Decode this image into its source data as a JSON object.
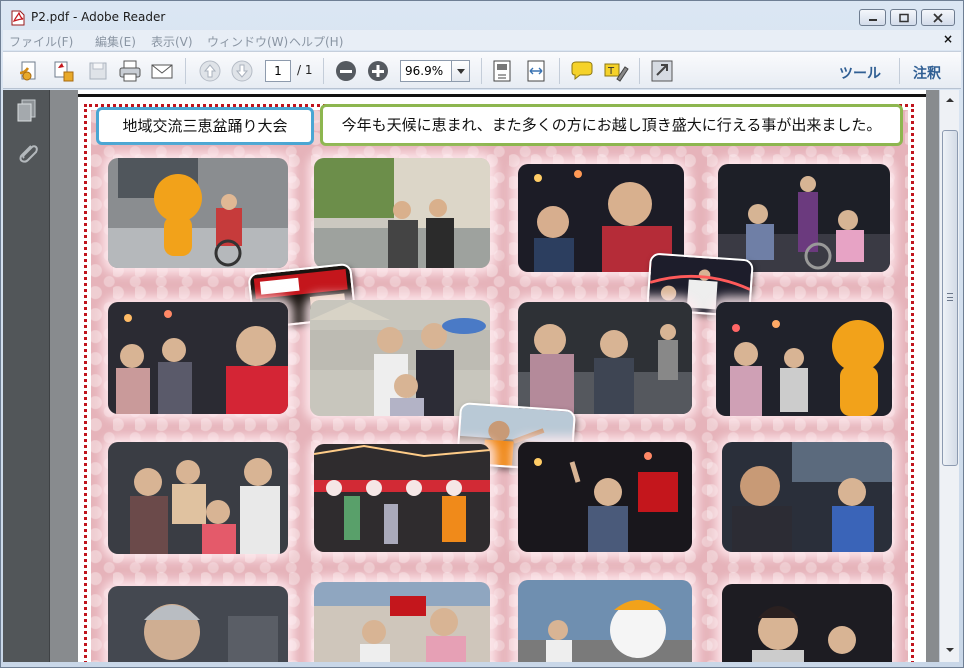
{
  "window": {
    "title": "P2.pdf - Adobe Reader"
  },
  "menu": {
    "items": [
      "ファイル(F)",
      "編集(E)",
      "表示(V)",
      "ウィンドウ(W)",
      "ヘルプ(H)"
    ]
  },
  "toolbar": {
    "page_current": "1",
    "page_total": "/ 1",
    "zoom": "96.9%",
    "tools_label": "ツール",
    "comment_label": "注釈"
  },
  "document": {
    "title_label": "地域交流三恵盆踊り大会",
    "message": "今年も天候に恵まれ、また多くの方にお越し頂き盛大に行える事が出来ました。"
  },
  "colors": {
    "title_border": "#4aa6d3",
    "message_border": "#8db64f",
    "frame_border": "#c0141d",
    "page_bg": "#e6b3ba",
    "link_blue": "#2f5e93"
  },
  "icons": {
    "nav": [
      "pages-icon",
      "attachments-icon"
    ],
    "toolbar": [
      "create-pdf-icon",
      "combine-icon",
      "save-icon",
      "print-icon",
      "email-icon",
      "previous-page-icon",
      "next-page-icon",
      "zoom-out-icon",
      "zoom-in-icon",
      "fit-page-icon",
      "fit-width-icon",
      "sticky-note-icon",
      "highlight-text-icon",
      "full-screen-icon"
    ]
  }
}
